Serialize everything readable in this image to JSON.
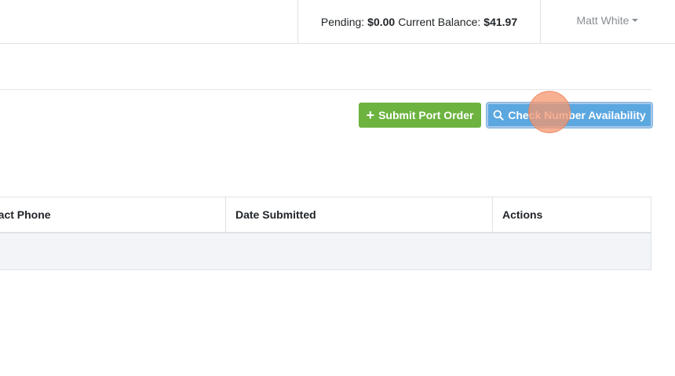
{
  "header": {
    "pending_label": "Pending:",
    "pending_amount": "$0.00",
    "balance_label": "Current Balance:",
    "balance_amount": "$41.97",
    "user_name": "Matt White"
  },
  "toolbar": {
    "submit_label": "Submit Port Order",
    "check_label": "Check Number Availability"
  },
  "table": {
    "columns": [
      "tact Phone",
      "Date Submitted",
      "Actions"
    ]
  },
  "icons": {
    "submit": "plus-icon",
    "check": "search-icon"
  },
  "colors": {
    "submit_button": "#6cb33f",
    "check_button": "#5ba7e0",
    "click_marker": "#f4966e"
  }
}
